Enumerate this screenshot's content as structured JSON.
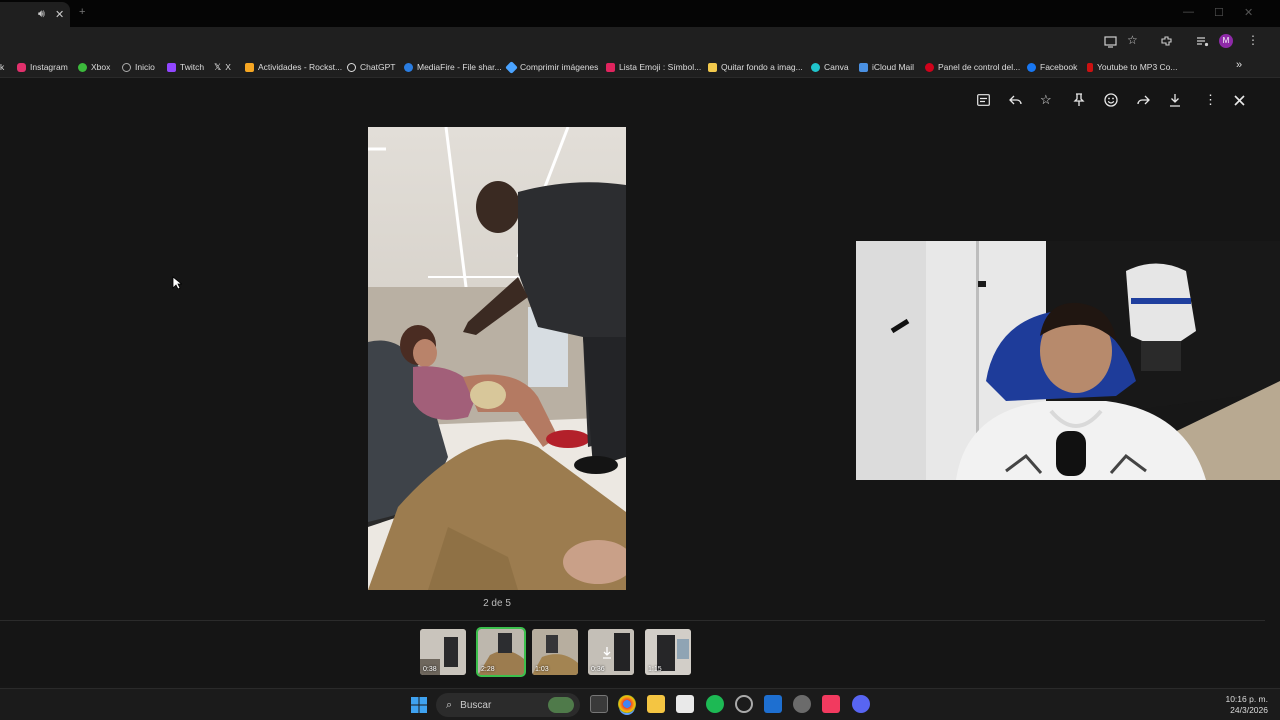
{
  "browser": {
    "tab_sound_icon": "speaker-icon",
    "new_tab_label": "+",
    "bookmarks": [
      {
        "label": "k",
        "color": "#888888"
      },
      {
        "label": "Instagram",
        "color": "#e1306c"
      },
      {
        "label": "Xbox",
        "color": "#3cba3c"
      },
      {
        "label": "Inicio",
        "color": "#aaaaaa"
      },
      {
        "label": "Twitch",
        "color": "#9146ff"
      },
      {
        "label": "X",
        "color": "#ffffff"
      },
      {
        "label": "Actividades - Rockst...",
        "color": "#f5a623"
      },
      {
        "label": "ChatGPT",
        "color": "#dddddd"
      },
      {
        "label": "MediaFire - File shar...",
        "color": "#2a7de1"
      },
      {
        "label": "Comprimir imágenes",
        "color": "#4aa3ff"
      },
      {
        "label": "Lista Emoji : Símbol...",
        "color": "#e0245e"
      },
      {
        "label": "Quitar fondo a imag...",
        "color": "#f2c94c"
      },
      {
        "label": "Canva",
        "color": "#20c4cb"
      },
      {
        "label": "iCloud Mail",
        "color": "#4a90e2"
      },
      {
        "label": "Panel de control del...",
        "color": "#d0021b"
      },
      {
        "label": "Facebook",
        "color": "#1877f2"
      },
      {
        "label": "Youtube to MP3 Co...",
        "color": "#cc1111"
      }
    ],
    "more_bookmarks": "»",
    "profile_initial": "M"
  },
  "viewer": {
    "counter_text": "2 de 5",
    "toolbar_icons": [
      "caption-icon",
      "reply-icon",
      "star-icon",
      "pin-icon",
      "emoji-icon",
      "forward-icon",
      "download-icon",
      "more-icon",
      "close-icon"
    ],
    "thumbnails": [
      {
        "duration": "0:38",
        "selected": false
      },
      {
        "duration": "2:28",
        "selected": true
      },
      {
        "duration": "1:03",
        "selected": false
      },
      {
        "duration": "0:36",
        "selected": false
      },
      {
        "duration": "1:15",
        "selected": false
      }
    ]
  },
  "taskbar": {
    "search_placeholder": "Buscar",
    "time": "10:16 p. m.",
    "date": "24/3/2026"
  }
}
